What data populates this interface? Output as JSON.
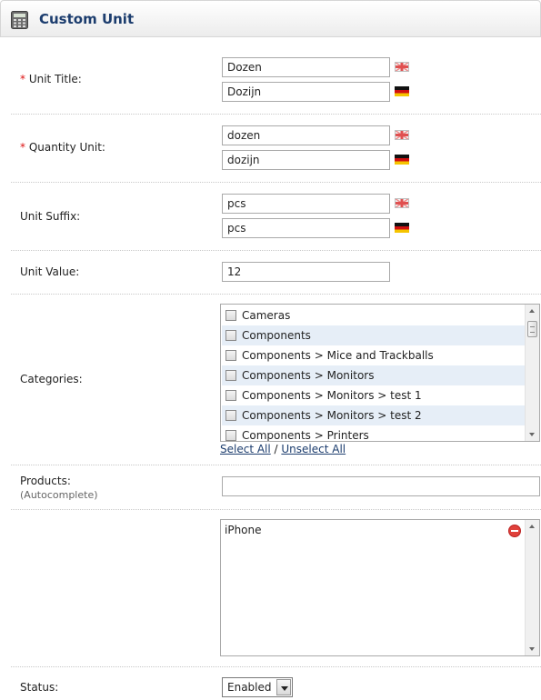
{
  "header": {
    "title": "Custom Unit",
    "icon": "calculator-icon"
  },
  "fields": {
    "unit_title": {
      "required_mark": "*",
      "label": "Unit Title:",
      "en": "Dozen",
      "de": "Dozijn"
    },
    "quantity_unit": {
      "required_mark": "*",
      "label": "Quantity Unit:",
      "en": "dozen",
      "de": "dozijn"
    },
    "unit_suffix": {
      "label": "Unit Suffix:",
      "en": "pcs",
      "de": "pcs"
    },
    "unit_value": {
      "label": "Unit Value:",
      "value": "12"
    },
    "categories": {
      "label": "Categories:",
      "items": [
        "Cameras",
        "Components",
        "Components > Mice and Trackballs",
        "Components > Monitors",
        "Components > Monitors > test 1",
        "Components > Monitors > test 2",
        "Components > Printers"
      ],
      "select_all": "Select All",
      "separator": " / ",
      "unselect_all": "Unselect All"
    },
    "products": {
      "label": "Products:",
      "sublabel": "(Autocomplete)",
      "value": "",
      "selected": [
        "iPhone"
      ]
    },
    "status": {
      "label": "Status:",
      "value": "Enabled"
    }
  },
  "colors": {
    "title": "#1c3d6e",
    "required": "#dd1111",
    "row_alt": "#e6eef7"
  }
}
